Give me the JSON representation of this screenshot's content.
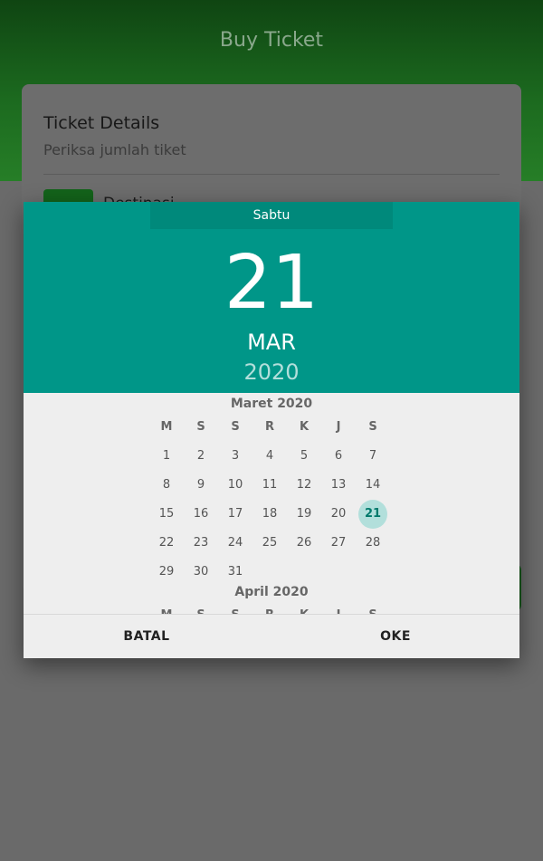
{
  "app": {
    "title": "Buy Ticket",
    "card_title": "Ticket Details",
    "card_subtitle": "Periksa jumlah tiket",
    "destination_label": "Destinasi"
  },
  "picker": {
    "weekday": "Sabtu",
    "day": "21",
    "month": "MAR",
    "year": "2020",
    "cancel_label": "BATAL",
    "ok_label": "OKE",
    "weekday_headers": [
      "M",
      "S",
      "S",
      "R",
      "K",
      "J",
      "S"
    ],
    "months": [
      {
        "title": "Maret 2020",
        "weeks": [
          [
            "1",
            "2",
            "3",
            "4",
            "5",
            "6",
            "7"
          ],
          [
            "8",
            "9",
            "10",
            "11",
            "12",
            "13",
            "14"
          ],
          [
            "15",
            "16",
            "17",
            "18",
            "19",
            "20",
            "21"
          ],
          [
            "22",
            "23",
            "24",
            "25",
            "26",
            "27",
            "28"
          ],
          [
            "29",
            "30",
            "31",
            "",
            "",
            "",
            ""
          ]
        ],
        "selected": "21"
      },
      {
        "title": "April 2020",
        "weeks": []
      }
    ],
    "colors": {
      "header": "#009688",
      "weekday_bar": "#00897b",
      "selected_circle": "#b2dfdb"
    }
  }
}
